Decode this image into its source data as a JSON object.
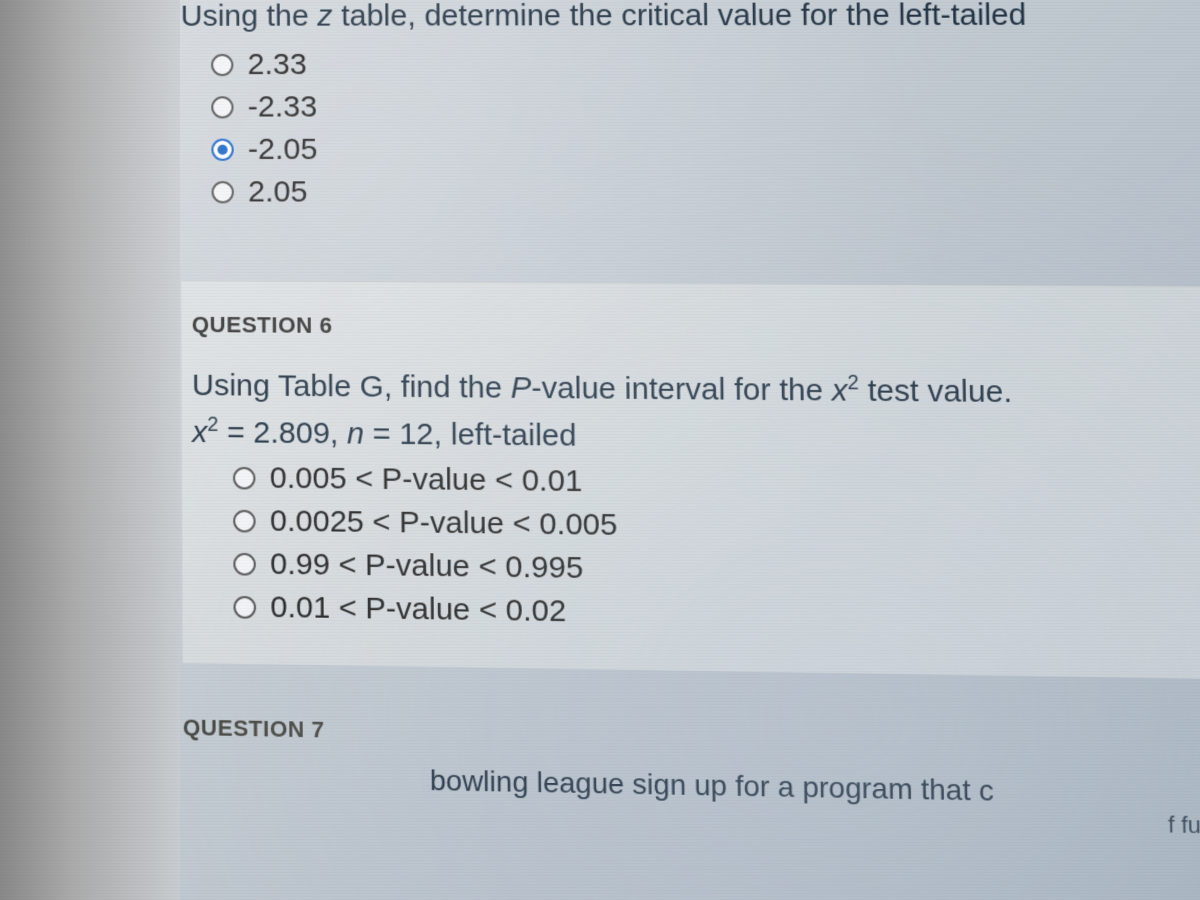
{
  "q5": {
    "prompt_prefix": "Using the ",
    "prompt_var": "z",
    "prompt_suffix": " table, determine the critical value for the left-tailed",
    "options": [
      {
        "label": "2.33",
        "selected": false
      },
      {
        "label": "-2.33",
        "selected": false
      },
      {
        "label": "-2.05",
        "selected": true
      },
      {
        "label": "2.05",
        "selected": false
      }
    ]
  },
  "q6": {
    "header": "QUESTION 6",
    "prompt_prefix": "Using Table G, find the ",
    "prompt_pval": "P",
    "prompt_mid": "-value interval for the ",
    "prompt_chi_base": "x",
    "prompt_chi_sup": "2",
    "prompt_suffix": " test value.",
    "given_chi_base": "x",
    "given_chi_sup": "2",
    "given_eq": " = 2.809, ",
    "given_n": "n",
    "given_rest": " = 12, left-tailed",
    "options": [
      {
        "label": "0.005 < P-value < 0.01",
        "selected": false
      },
      {
        "label": "0.0025 < P-value < 0.005",
        "selected": false
      },
      {
        "label": "0.99 < P-value < 0.995",
        "selected": false
      },
      {
        "label": "0.01 < P-value < 0.02",
        "selected": false
      }
    ]
  },
  "q7": {
    "header": "QUESTION 7",
    "partial_text": "bowling league sign up for a program that c",
    "sub_partial": "f fun gar"
  }
}
